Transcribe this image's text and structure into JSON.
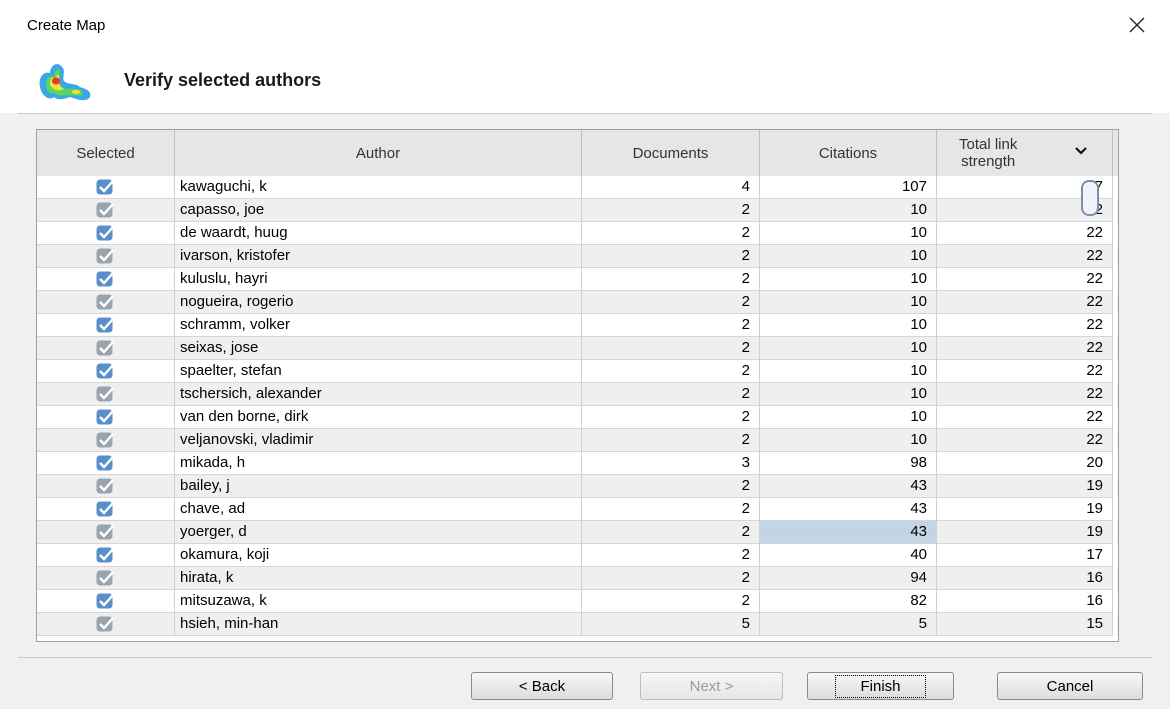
{
  "window": {
    "title": "Create Map"
  },
  "header": {
    "title": "Verify selected authors"
  },
  "table": {
    "columns": {
      "selected": "Selected",
      "author": "Author",
      "documents": "Documents",
      "citations": "Citations",
      "total_line1": "Total link",
      "total_line2": "strength"
    },
    "sorted_column": "Total link strength",
    "rows": [
      {
        "author": "kawaguchi, k",
        "documents": "4",
        "citations": "107",
        "total": "27",
        "selected": true
      },
      {
        "author": "capasso, joe",
        "documents": "2",
        "citations": "10",
        "total": "22",
        "selected": true
      },
      {
        "author": "de waardt, huug",
        "documents": "2",
        "citations": "10",
        "total": "22",
        "selected": true
      },
      {
        "author": "ivarson, kristofer",
        "documents": "2",
        "citations": "10",
        "total": "22",
        "selected": true
      },
      {
        "author": "kuluslu, hayri",
        "documents": "2",
        "citations": "10",
        "total": "22",
        "selected": true
      },
      {
        "author": "nogueira, rogerio",
        "documents": "2",
        "citations": "10",
        "total": "22",
        "selected": true
      },
      {
        "author": "schramm, volker",
        "documents": "2",
        "citations": "10",
        "total": "22",
        "selected": true
      },
      {
        "author": "seixas, jose",
        "documents": "2",
        "citations": "10",
        "total": "22",
        "selected": true
      },
      {
        "author": "spaelter, stefan",
        "documents": "2",
        "citations": "10",
        "total": "22",
        "selected": true
      },
      {
        "author": "tschersich, alexander",
        "documents": "2",
        "citations": "10",
        "total": "22",
        "selected": true
      },
      {
        "author": "van den borne, dirk",
        "documents": "2",
        "citations": "10",
        "total": "22",
        "selected": true
      },
      {
        "author": "veljanovski, vladimir",
        "documents": "2",
        "citations": "10",
        "total": "22",
        "selected": true
      },
      {
        "author": "mikada, h",
        "documents": "3",
        "citations": "98",
        "total": "20",
        "selected": true
      },
      {
        "author": "bailey, j",
        "documents": "2",
        "citations": "43",
        "total": "19",
        "selected": true
      },
      {
        "author": "chave, ad",
        "documents": "2",
        "citations": "43",
        "total": "19",
        "selected": true
      },
      {
        "author": "yoerger, d",
        "documents": "2",
        "citations": "43",
        "total": "19",
        "selected": true
      },
      {
        "author": "okamura, koji",
        "documents": "2",
        "citations": "40",
        "total": "17",
        "selected": true
      },
      {
        "author": "hirata, k",
        "documents": "2",
        "citations": "94",
        "total": "16",
        "selected": true
      },
      {
        "author": "mitsuzawa, k",
        "documents": "2",
        "citations": "82",
        "total": "16",
        "selected": true
      },
      {
        "author": "hsieh, min-han",
        "documents": "5",
        "citations": "5",
        "total": "15",
        "selected": true
      }
    ],
    "highlighted_cell": {
      "row": 15,
      "column": "citations"
    }
  },
  "buttons": {
    "back": "< Back",
    "next": "Next >",
    "finish": "Finish",
    "cancel": "Cancel"
  },
  "colors": {
    "accent_checkbox": "#5b8fc9",
    "highlight": "#c3d4e4"
  }
}
